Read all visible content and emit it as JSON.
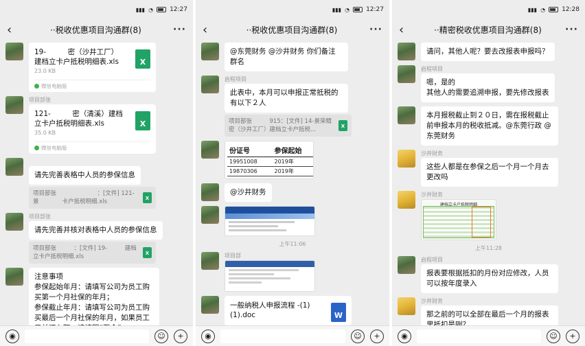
{
  "phones": [
    {
      "status_time": "12:27",
      "title": "··税收优惠项目沟通群(8)",
      "messages": [
        {
          "type": "file",
          "name": "19-　　　密（沙井工厂）建档立卡户抵税明细表.xls",
          "size": "23.0 KB",
          "source": "微信电脑版",
          "icon": "excel-icon",
          "badge": "X"
        },
        {
          "type": "file",
          "nick": "项目部张",
          "name": "121-　　　密（清溪）建档立卡户抵税明细表.xls",
          "size": "35.0 KB",
          "source": "微信电脑版",
          "icon": "excel-icon",
          "badge": "X"
        },
        {
          "type": "text",
          "nick": "",
          "text": "请先完善表格中人员的参保信息",
          "quote": "项目部张　　　　　　　：[文件] 121-景　　　　卡户抵税明细.xls"
        },
        {
          "type": "text",
          "nick": "项目部张",
          "text": "请先完善并核对表格中人员的参保信息",
          "quote": "项目部张　　　：[文件] 19-　　　建档立卡户抵税明细.xls"
        },
        {
          "type": "text",
          "nick": "",
          "text": "注意事项\n参保起始年月：请填写公司为员工购买第一个月社保的年月；\n参保截止年月：请填写公司为员工购买最后一个月社保的年月，如果员工目前还在职，请填写“至今”。"
        }
      ]
    },
    {
      "status_time": "12:27",
      "title": "··税收优惠项目沟通群(8)",
      "messages": [
        {
          "type": "text",
          "nick": "",
          "text": "@东莞财务 @沙井财务  你们备注群名"
        },
        {
          "type": "text",
          "nick": "启程项目",
          "text": "此表中，本月可以申报正常抵税的有以下２人",
          "quote": "项目部张　　　915：[文件] 14-景荣精密（沙井工厂）建档立卡户抵税..."
        },
        {
          "type": "table",
          "nick": "",
          "headers": [
            "份证号",
            "参保起始"
          ],
          "rows": [
            [
              "19951008",
              "2019年"
            ],
            [
              "19870306",
              "2019年"
            ]
          ]
        },
        {
          "type": "text",
          "nick": "",
          "text": "@沙井财务"
        },
        {
          "type": "image",
          "nick": ""
        },
        {
          "type": "time",
          "text": "上午11:06"
        },
        {
          "type": "image2",
          "nick": "项目部"
        },
        {
          "type": "file",
          "nick": "",
          "name": "一般纳税人申报流程 -(1)(1).doc",
          "size": "",
          "source": "",
          "icon": "word-icon",
          "badge": "W"
        }
      ]
    },
    {
      "status_time": "12:28",
      "title": "··精密税收优惠项目沟通群(8)",
      "messages": [
        {
          "type": "text",
          "nick": "",
          "text": "请问，其他人呢？要去改报表申报吗？"
        },
        {
          "type": "text",
          "nick": "启程项目",
          "text": "嗯，是的\n其他人的需要追溯申报，要先修改报表"
        },
        {
          "type": "text",
          "nick": "",
          "text": "本月报税截止到２０日，需在报税截止前申报本月的税收抵减。@东莞行政 @东莞财务"
        },
        {
          "type": "text",
          "nick": "沙井财务",
          "gold": true,
          "text": "这些人都是在参保之后一个月一个月去更改吗"
        },
        {
          "type": "sheet",
          "nick": "沙井财务",
          "gold": true,
          "caption": "建档立卡户抵税明细"
        },
        {
          "type": "time",
          "text": "上午11:28"
        },
        {
          "type": "text",
          "nick": "启程项目",
          "text": "报表要根据抵扣的月份对应修改，人员可以按年度录入"
        },
        {
          "type": "text",
          "nick": "沙井财务",
          "gold": true,
          "text": "那之前的可以全部在最后一个月的报表里抵扣是咧？"
        }
      ]
    }
  ]
}
